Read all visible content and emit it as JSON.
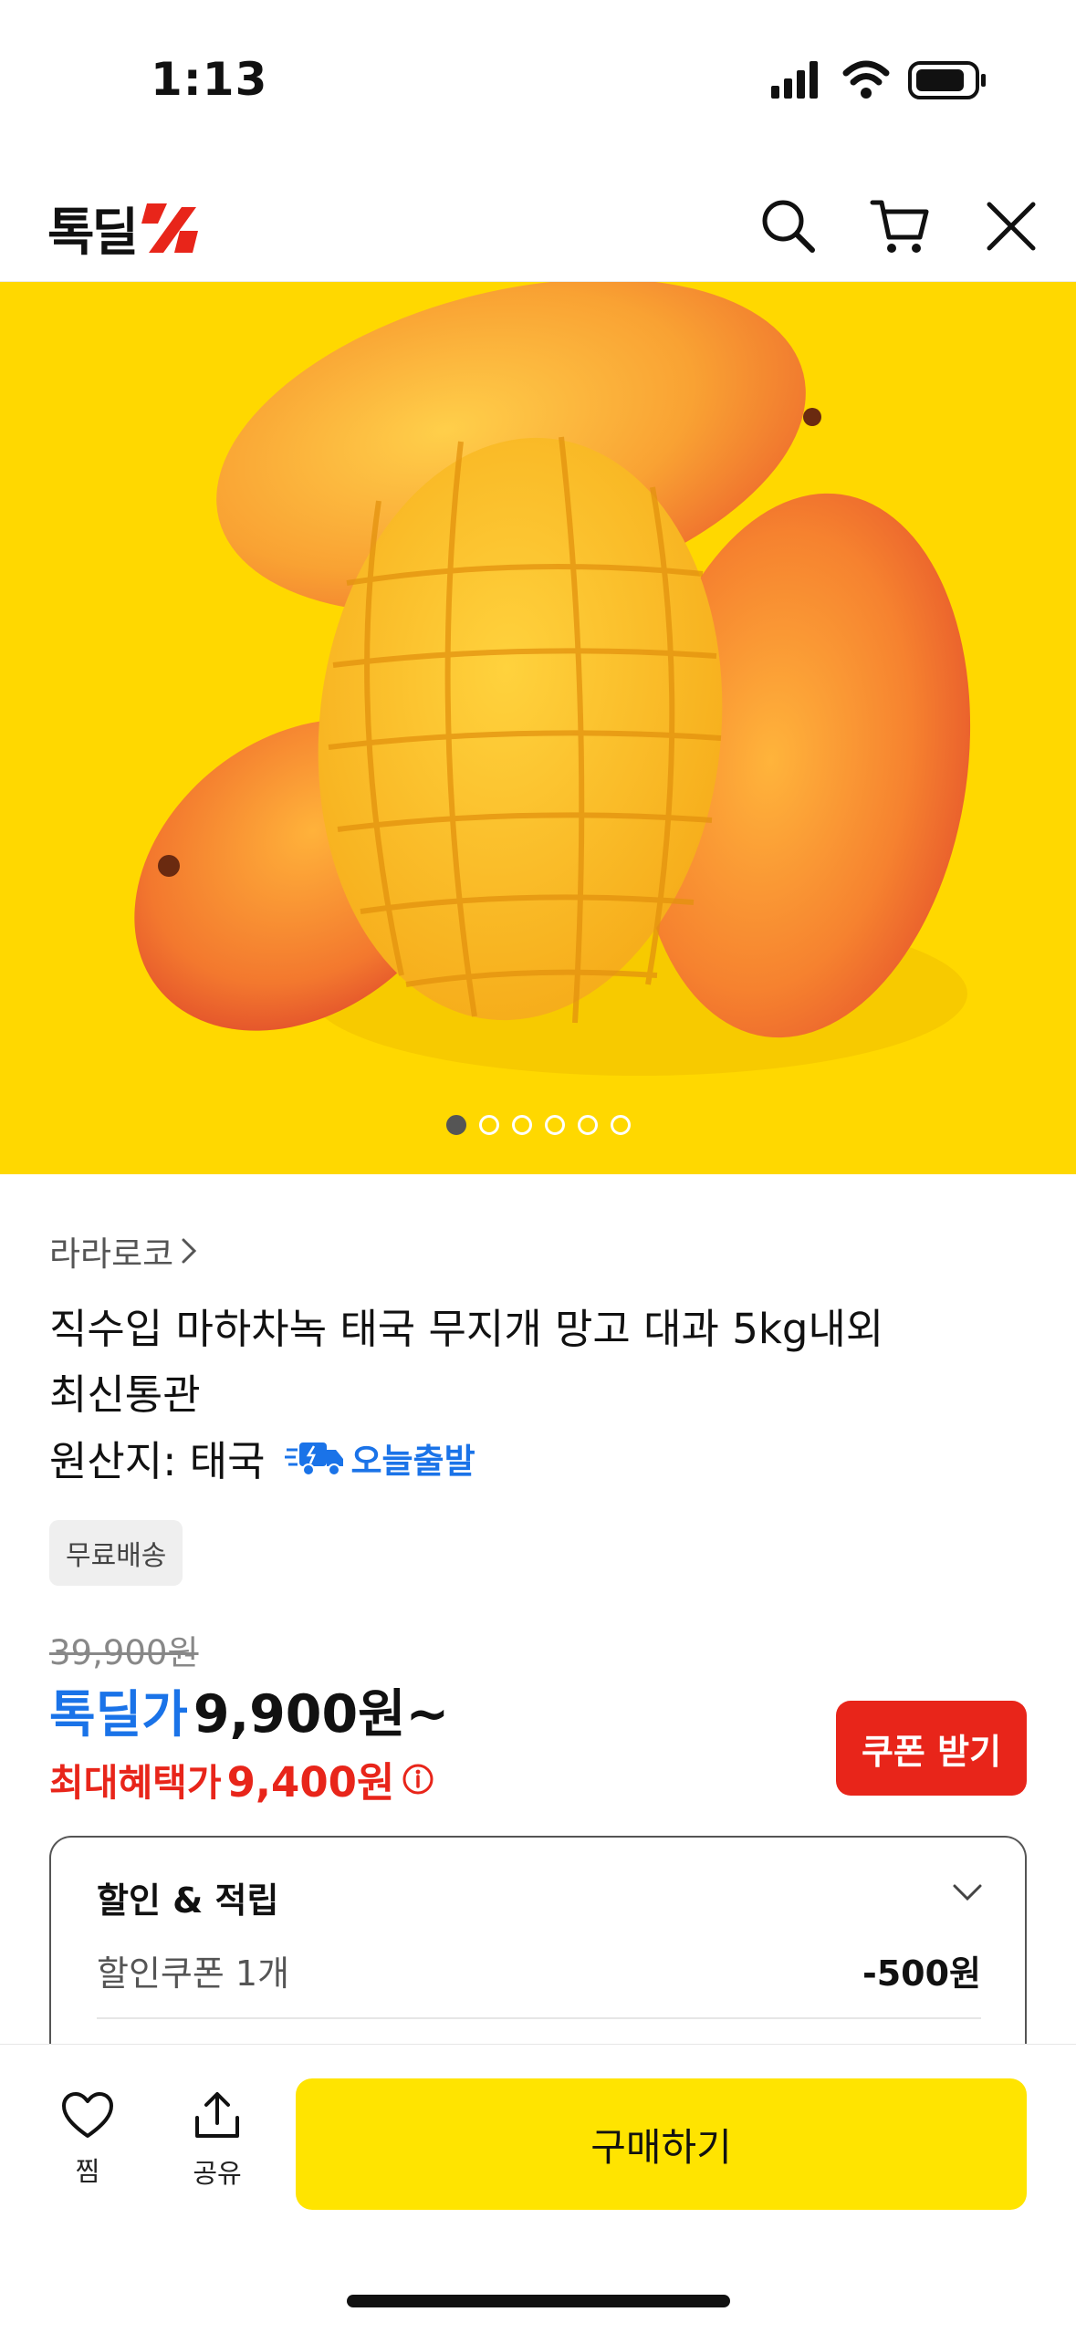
{
  "status_bar": {
    "time": "1:13"
  },
  "header": {
    "logo_text": "톡딜",
    "icons": [
      "search-icon",
      "cart-icon",
      "close-icon"
    ]
  },
  "hero": {
    "image": "mango-photo",
    "slide_count": 6,
    "active_slide": 1
  },
  "product": {
    "brand": "라라로코",
    "title_line1": "직수입 마하차녹 태국 무지개 망고 대과 5kg내외",
    "title_line2": "최신통관",
    "origin": "원산지: 태국",
    "shipping_badge": "오늘출발",
    "free_shipping": "무료배송"
  },
  "pricing": {
    "original_price": "39,900원",
    "deal_label": "톡딜가",
    "deal_price": "9,900원~",
    "max_benefit_label": "최대혜택가",
    "max_benefit_price": "9,400원",
    "coupon_button": "쿠폰 받기"
  },
  "discount": {
    "title": "할인 & 적립",
    "row_label": "할인쿠폰 1개",
    "row_value": "-500원"
  },
  "bottom_bar": {
    "wish_label": "찜",
    "share_label": "공유",
    "buy_label": "구매하기"
  },
  "colors": {
    "accent_blue": "#1a73e8",
    "accent_red": "#e8251a",
    "hero_yellow": "#ffd800",
    "buy_yellow": "#ffe400"
  }
}
